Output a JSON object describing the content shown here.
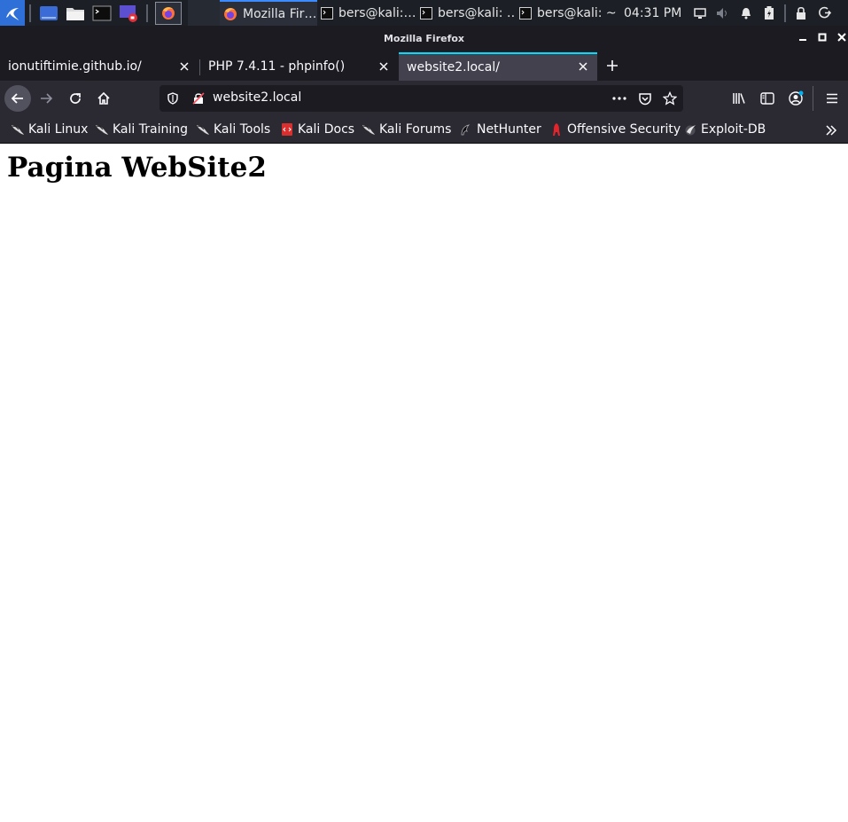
{
  "taskbar": {
    "windows": [
      {
        "label": "Mozilla Fir…",
        "icon": "firefox-icon",
        "active": true
      },
      {
        "label": "bers@kali:…",
        "icon": "terminal-icon",
        "active": false
      },
      {
        "label": "bers@kali: …",
        "icon": "terminal-icon",
        "active": false
      },
      {
        "label": "bers@kali: ~",
        "icon": "terminal-icon",
        "active": false
      }
    ],
    "clock": "04:31 PM"
  },
  "window": {
    "title": "Mozilla Firefox"
  },
  "tabs": [
    {
      "label": "ionutiftimie.github.io/",
      "active": false
    },
    {
      "label": "PHP 7.4.11 - phpinfo()",
      "active": false
    },
    {
      "label": "website2.local/",
      "active": true
    }
  ],
  "urlbar": {
    "url": "website2.local"
  },
  "bookmarks": [
    {
      "label": "Kali Linux",
      "icon": "kali-dragon-icon"
    },
    {
      "label": "Kali Training",
      "icon": "kali-dragon-icon"
    },
    {
      "label": "Kali Tools",
      "icon": "kali-dragon-icon"
    },
    {
      "label": "Kali Docs",
      "icon": "kali-docs-icon"
    },
    {
      "label": "Kali Forums",
      "icon": "kali-dragon-icon"
    },
    {
      "label": "NetHunter",
      "icon": "nethunter-icon"
    },
    {
      "label": "Offensive Security",
      "icon": "offsec-icon"
    },
    {
      "label": "Exploit-DB",
      "icon": "exploit-db-icon"
    }
  ],
  "page": {
    "heading": "Pagina WebSite2"
  },
  "colors": {
    "accent": "#00ddff",
    "taskbar_bg": "#1c1f26",
    "toolbar_bg": "#2b2a33",
    "tab_active_bg": "#42414d"
  }
}
